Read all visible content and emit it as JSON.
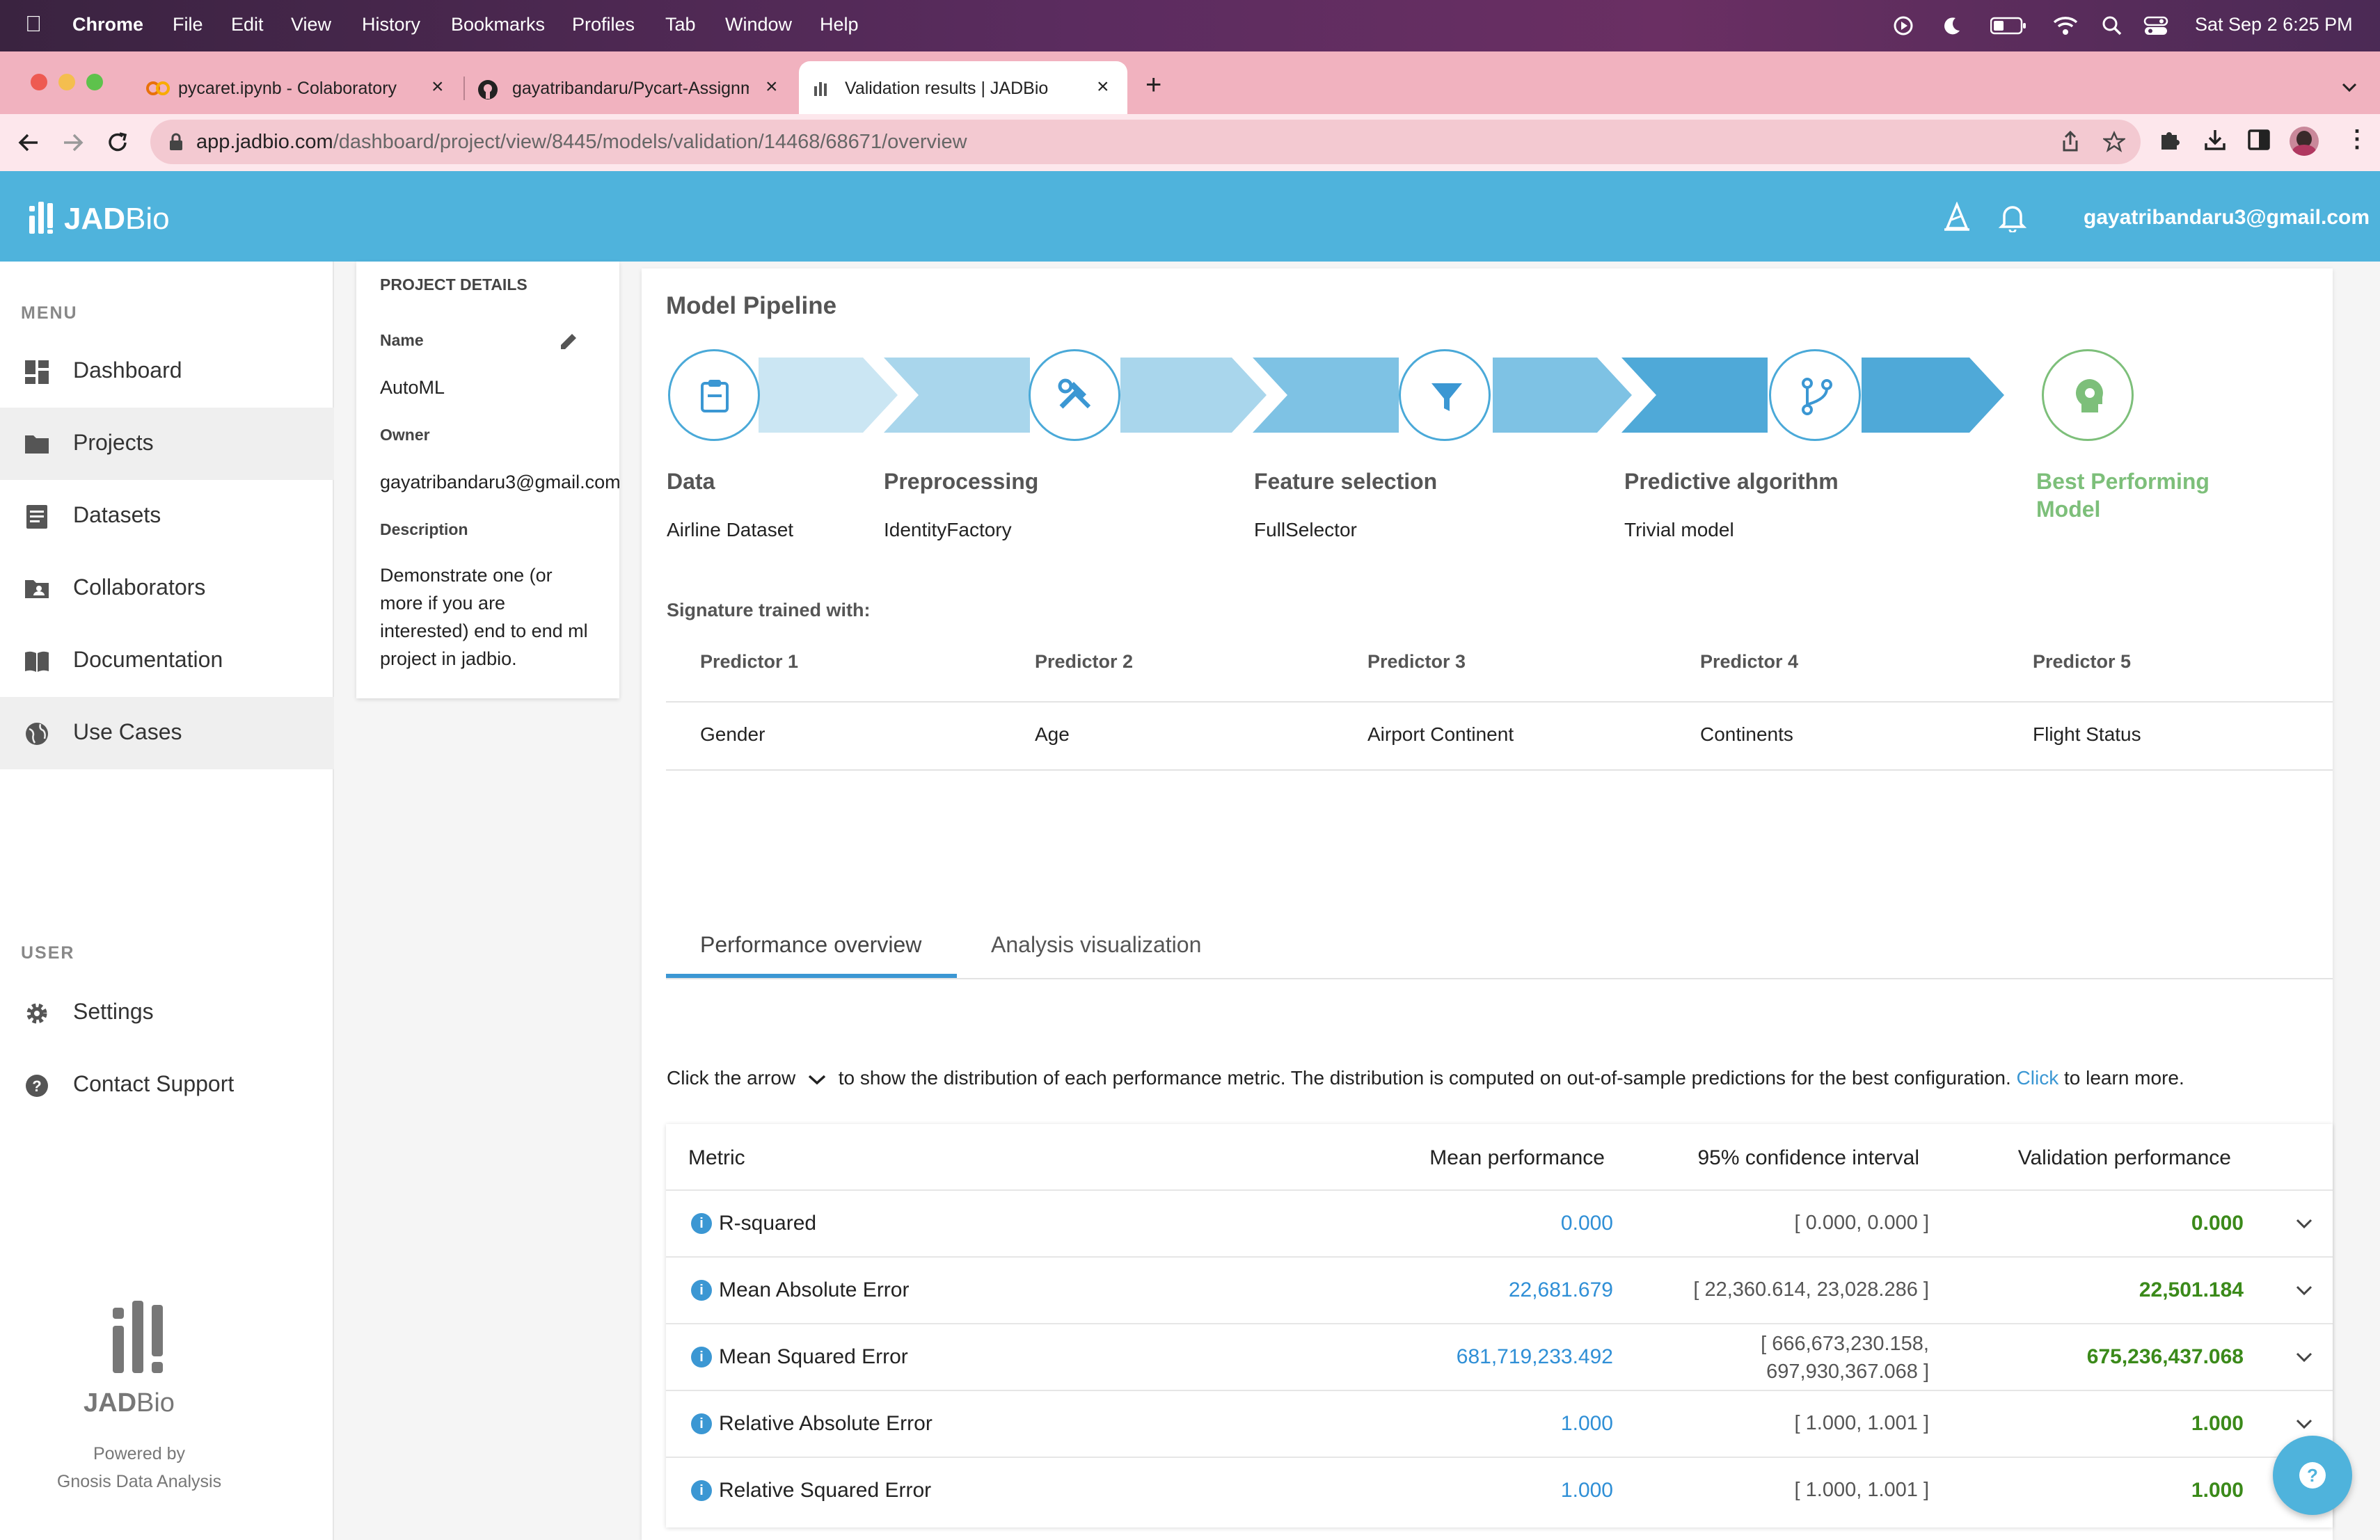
{
  "menubar": {
    "app": "Chrome",
    "items": [
      "File",
      "Edit",
      "View",
      "History",
      "Bookmarks",
      "Profiles",
      "Tab",
      "Window",
      "Help"
    ],
    "clock": "Sat Sep 2  6:25 PM"
  },
  "tabs": [
    {
      "title": "pycaret.ipynb - Colaboratory"
    },
    {
      "title": "gayatribandaru/Pycart-Assignm"
    },
    {
      "title": "Validation results | JADBio"
    }
  ],
  "url": {
    "host": "app.jadbio.com",
    "path": "/dashboard/project/view/8445/models/validation/14468/68671/overview"
  },
  "header": {
    "brand_bold": "JAD",
    "brand_light": "Bio",
    "user_email": "gayatribandaru3@gmail.com"
  },
  "sidebar": {
    "menu_heading": "MENU",
    "items": [
      {
        "label": "Dashboard",
        "icon": "dashboard-icon"
      },
      {
        "label": "Projects",
        "icon": "folder-icon"
      },
      {
        "label": "Datasets",
        "icon": "list-icon"
      },
      {
        "label": "Collaborators",
        "icon": "shared-folder-icon"
      },
      {
        "label": "Documentation",
        "icon": "book-icon"
      },
      {
        "label": "Use Cases",
        "icon": "globe-icon"
      }
    ],
    "user_heading": "USER",
    "user_items": [
      {
        "label": "Settings",
        "icon": "gear-icon"
      },
      {
        "label": "Contact Support",
        "icon": "help-icon"
      }
    ],
    "footer": {
      "brand_bold": "JAD",
      "brand_light": "Bio",
      "powered": "Powered by",
      "company": "Gnosis Data Analysis"
    }
  },
  "project": {
    "heading": "PROJECT DETAILS",
    "name_label": "Name",
    "name": "AutoML",
    "owner_label": "Owner",
    "owner": "gayatribandaru3@gmail.com",
    "description_label": "Description",
    "description": [
      "Demonstrate one (or",
      "more if you are",
      "interested) end to end ml",
      "project in jadbio."
    ]
  },
  "pipeline": {
    "title": "Model Pipeline",
    "steps": [
      {
        "title": "Data",
        "value": "Airline Dataset",
        "icon": "clipboard-icon"
      },
      {
        "title": "Preprocessing",
        "value": "IdentityFactory",
        "icon": "tools-icon"
      },
      {
        "title": "Feature selection",
        "value": "FullSelector",
        "icon": "filter-icon"
      },
      {
        "title": "Predictive algorithm",
        "value": "Trivial model",
        "icon": "branch-icon"
      }
    ],
    "best": [
      "Best Performing",
      "Model"
    ],
    "colors": {
      "accent": "#4aa9d8",
      "best": "#7dbf7a"
    }
  },
  "signature": {
    "label": "Signature trained with:",
    "headers": [
      "Predictor 1",
      "Predictor 2",
      "Predictor 3",
      "Predictor 4",
      "Predictor 5"
    ],
    "values": [
      "Gender",
      "Age",
      "Airport Continent",
      "Continents",
      "Flight Status"
    ]
  },
  "perf_tabs": [
    "Performance overview",
    "Analysis visualization"
  ],
  "explain": {
    "before": "Click the arrow",
    "after": "to show the distribution of each performance metric. The distribution is computed on out-of-sample predictions for the best configuration.",
    "link": "Click",
    "tail": "to learn more."
  },
  "metrics": {
    "headers": [
      "Metric",
      "Mean performance",
      "95% confidence interval",
      "Validation performance"
    ],
    "rows": [
      {
        "name": "R-squared",
        "mean": "0.000",
        "ci": "[ 0.000, 0.000 ]",
        "val": "0.000"
      },
      {
        "name": "Mean Absolute Error",
        "mean": "22,681.679",
        "ci": "[ 22,360.614, 23,028.286 ]",
        "val": "22,501.184"
      },
      {
        "name": "Mean Squared Error",
        "mean": "681,719,233.492",
        "ci_line1": "[ 666,673,230.158,",
        "ci_line2": "697,930,367.068 ]",
        "val": "675,236,437.068"
      },
      {
        "name": "Relative Absolute Error",
        "mean": "1.000",
        "ci": "[ 1.000, 1.001 ]",
        "val": "1.000"
      },
      {
        "name": "Relative Squared Error",
        "mean": "1.000",
        "ci": "[ 1.000, 1.001 ]",
        "val": "1.000"
      }
    ]
  }
}
